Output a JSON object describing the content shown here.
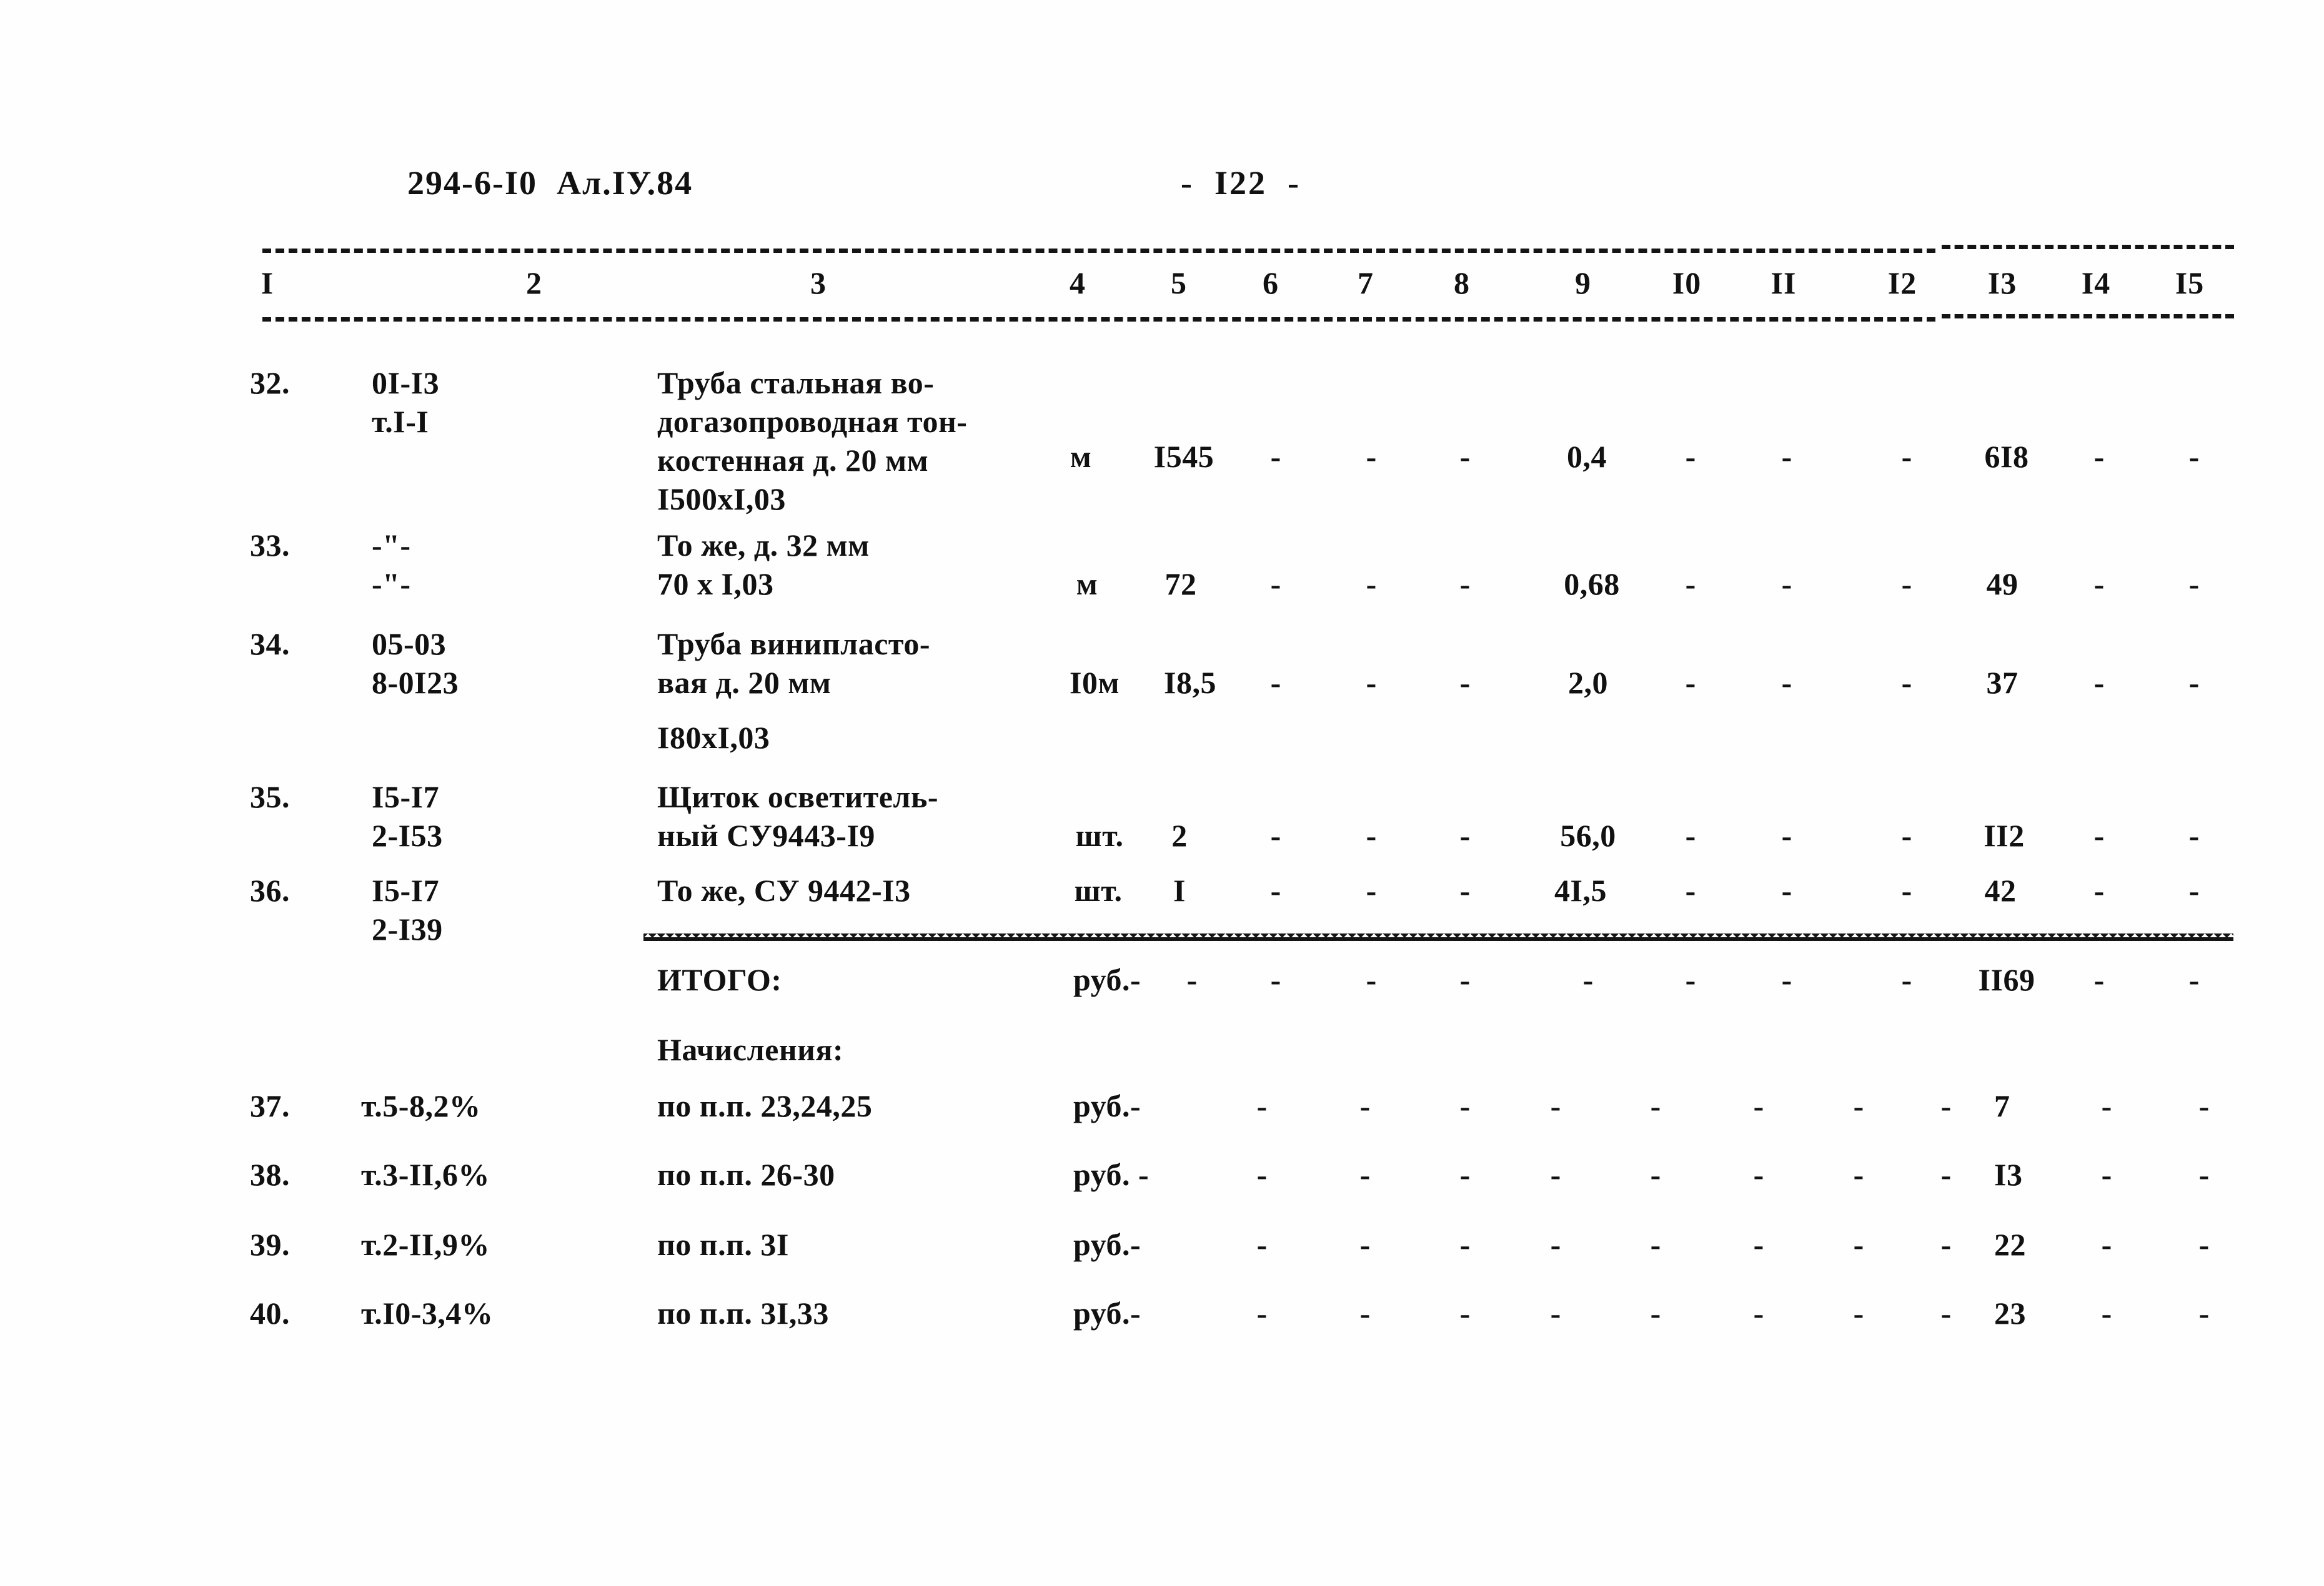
{
  "document": {
    "code": "294-6-I0  Ал.IУ.84",
    "page_marker": "-  I22  -"
  },
  "table": {
    "column_headers": [
      "I",
      "2",
      "3",
      "4",
      "5",
      "6",
      "7",
      "8",
      "9",
      "I0",
      "II",
      "I2",
      "I3",
      "I4",
      "I5"
    ],
    "dash": "-",
    "rows": [
      {
        "no": "32.",
        "code": "0I-I3\nт.I-I",
        "name": "Труба стальная во-\nдогазопроводная тон-\nкостенная д. 20 мм\nI500xI,03",
        "unit": "м",
        "qty": "I545",
        "c6": "-",
        "c7": "-",
        "c8": "-",
        "c9": "0,4",
        "c10": "-",
        "c11": "-",
        "c12": "-",
        "c13": "6I8",
        "c14": "-",
        "c15": "-"
      },
      {
        "no": "33.",
        "code": "-\"-\n-\"-",
        "name": "То же, д. 32 мм\n70 х I,03",
        "unit": "м",
        "qty": "72",
        "c6": "-",
        "c7": "-",
        "c8": "-",
        "c9": "0,68",
        "c10": "-",
        "c11": "-",
        "c12": "-",
        "c13": "49",
        "c14": "-",
        "c15": "-"
      },
      {
        "no": "34.",
        "code": "05-03\n8-0I23",
        "name": "Труба винипласто-\nвая д. 20 мм",
        "name_extra": "I80xI,03",
        "unit": "I0м",
        "qty": "I8,5",
        "c6": "-",
        "c7": "-",
        "c8": "-",
        "c9": "2,0",
        "c10": "-",
        "c11": "-",
        "c12": "-",
        "c13": "37",
        "c14": "-",
        "c15": "-"
      },
      {
        "no": "35.",
        "code": "I5-I7\n2-I53",
        "name": "Щиток осветитель-\nный СУ9443-I9",
        "unit": "шт.",
        "qty": "2",
        "c6": "-",
        "c7": "-",
        "c8": "-",
        "c9": "56,0",
        "c10": "-",
        "c11": "-",
        "c12": "-",
        "c13": "II2",
        "c14": "-",
        "c15": "-"
      },
      {
        "no": "36.",
        "code": "I5-I7\n2-I39",
        "name": "То же, СУ 9442-I3",
        "unit": "шт.",
        "qty": "I",
        "c6": "-",
        "c7": "-",
        "c8": "-",
        "c9": "4I,5",
        "c10": "-",
        "c11": "-",
        "c12": "-",
        "c13": "42",
        "c14": "-",
        "c15": "-"
      }
    ],
    "total_row": {
      "label": "ИТОГО:",
      "unit": "руб.-",
      "c5": "-",
      "c6": "-",
      "c7": "-",
      "c8": "-",
      "c9": "-",
      "c10": "-",
      "c11": "-",
      "c12": "-",
      "c13": "II69",
      "c14": "-",
      "c15": "-"
    },
    "charges_label": "Начисления:",
    "charge_rows": [
      {
        "no": "37.",
        "code": "т.5-8,2%",
        "name": "по п.п. 23,24,25",
        "unit": "руб.-",
        "c5": "-",
        "c6": "-",
        "c7": "-",
        "c8": "-",
        "c9": "-",
        "c10": "-",
        "c11": "-",
        "c12": "-",
        "c13": "7",
        "c14": "-",
        "c15": "-"
      },
      {
        "no": "38.",
        "code": "т.3-II,6%",
        "name": "по п.п. 26-30",
        "unit": "руб. -",
        "c5": "-",
        "c6": "-",
        "c7": "-",
        "c8": "-",
        "c9": "-",
        "c10": "-",
        "c11": "-",
        "c12": "-",
        "c13": "I3",
        "c14": "-",
        "c15": "-"
      },
      {
        "no": "39.",
        "code": "т.2-II,9%",
        "name": "по п.п. 3I",
        "unit": "руб.-",
        "c5": "-",
        "c6": "-",
        "c7": "-",
        "c8": "-",
        "c9": "-",
        "c10": "-",
        "c11": "-",
        "c12": "-",
        "c13": "22",
        "c14": "-",
        "c15": "-"
      },
      {
        "no": "40.",
        "code": "т.I0-3,4%",
        "name": "по п.п. 3I,33",
        "unit": "руб.-",
        "c5": "-",
        "c6": "-",
        "c7": "-",
        "c8": "-",
        "c9": "-",
        "c10": "-",
        "c11": "-",
        "c12": "-",
        "c13": "23",
        "c14": "-",
        "c15": "-"
      }
    ]
  }
}
